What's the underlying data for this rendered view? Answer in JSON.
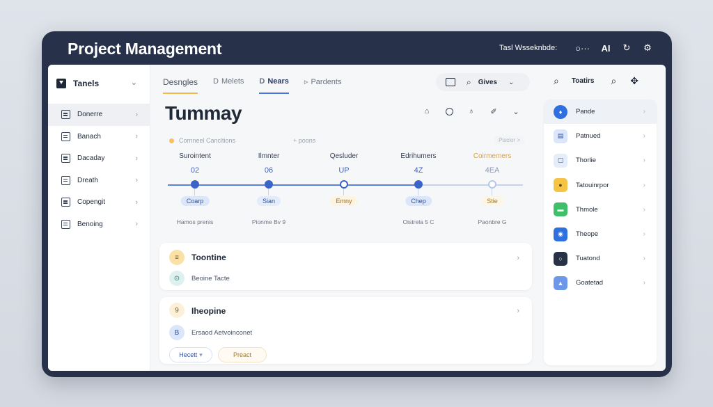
{
  "window": {
    "title": "Project Management",
    "toolbar": {
      "workspace_text": "Tasl Wsseknbde:",
      "dots_icon": "○···",
      "ai_label": "AI",
      "refresh_icon": "↻",
      "settings_icon": "⚙"
    }
  },
  "sidebar": {
    "title": "Tanels",
    "items": [
      {
        "label": "Donerre",
        "icon": "board-icon"
      },
      {
        "label": "Banach",
        "icon": "list-icon"
      },
      {
        "label": "Dacaday",
        "icon": "calendar-icon"
      },
      {
        "label": "Dreath",
        "icon": "edit-icon"
      },
      {
        "label": "Copengit",
        "icon": "chart-icon"
      },
      {
        "label": "Benoing",
        "icon": "inbox-icon"
      }
    ]
  },
  "tabs": [
    {
      "prefix": "",
      "label": "Desngles"
    },
    {
      "prefix": "D",
      "label": "Melets"
    },
    {
      "prefix": "D",
      "label": "Nears"
    },
    {
      "prefix": "▹",
      "label": "Pardents"
    }
  ],
  "filter": {
    "label": "Gives"
  },
  "summary": {
    "title": "Tummay",
    "legend_primary": "Cornneel Cancltions",
    "legend_secondary": "+ poons",
    "legend_chip": "Piscior >",
    "milestones": [
      {
        "name": "Surointent",
        "value": "02",
        "state": "done",
        "tag": "Coarp",
        "tag_color": "#dbe6fb",
        "tag_text_color": "#2f4f9c",
        "foot": "Hamos prenis"
      },
      {
        "name": "Ilmnter",
        "value": "06",
        "state": "done",
        "tag": "Sian",
        "tag_color": "#e3ecfb",
        "tag_text_color": "#2f4f9c",
        "foot": "Pionme Bv 9"
      },
      {
        "name": "Qesluder",
        "value": "UP",
        "state": "open",
        "tag": "Emny",
        "tag_color": "#fdf3e0",
        "tag_text_color": "#9a6d18",
        "foot": ""
      },
      {
        "name": "Edrihumers",
        "value": "4Z",
        "state": "done",
        "tag": "Chep",
        "tag_color": "#dbe6fb",
        "tag_text_color": "#2f4f9c",
        "foot": "Oistrela 5 C"
      },
      {
        "name": "Coirmemers",
        "value": "4EA",
        "state": "open-light",
        "tag": "Stie",
        "tag_color": "#fdf5e6",
        "tag_text_color": "#a07a2a",
        "foot": "Paonbre G"
      }
    ]
  },
  "tasks": [
    {
      "badge": "≡",
      "badge_color": "#fbe1a6",
      "title": "Toontine",
      "sub_badge": "⊙",
      "sub_badge_color": "#dff1ef",
      "sub": "Beoine Tacte"
    },
    {
      "badge": "9",
      "badge_color": "#fdf0d9",
      "title": "Iheopine",
      "sub_badge": "B",
      "sub_badge_color": "#dbe6fb",
      "sub": "Ersaod Aetvoinconet",
      "btn_primary": "Hecett",
      "btn_secondary": "Preact"
    }
  ],
  "right_panel": {
    "label": "Toatirs",
    "items": [
      {
        "label": "Pande",
        "icon_color": "#2f6fe0",
        "glyph": "♦",
        "active": true
      },
      {
        "label": "Patnued",
        "icon_color": "#dbe6fb",
        "glyph": "▤"
      },
      {
        "label": "Thorlie",
        "icon_color": "#e5edfb",
        "glyph": "▢"
      },
      {
        "label": "Tatouinrpor",
        "icon_color": "#f6c444",
        "glyph": "●"
      },
      {
        "label": "Thmole",
        "icon_color": "#3fbf6a",
        "glyph": "▬"
      },
      {
        "label": "Theope",
        "icon_color": "#2f6fe0",
        "glyph": "◉"
      },
      {
        "label": "Tuatond",
        "icon_color": "#273247",
        "glyph": "○"
      },
      {
        "label": "Goatetad",
        "icon_color": "#6d97ea",
        "glyph": "▲"
      }
    ]
  }
}
